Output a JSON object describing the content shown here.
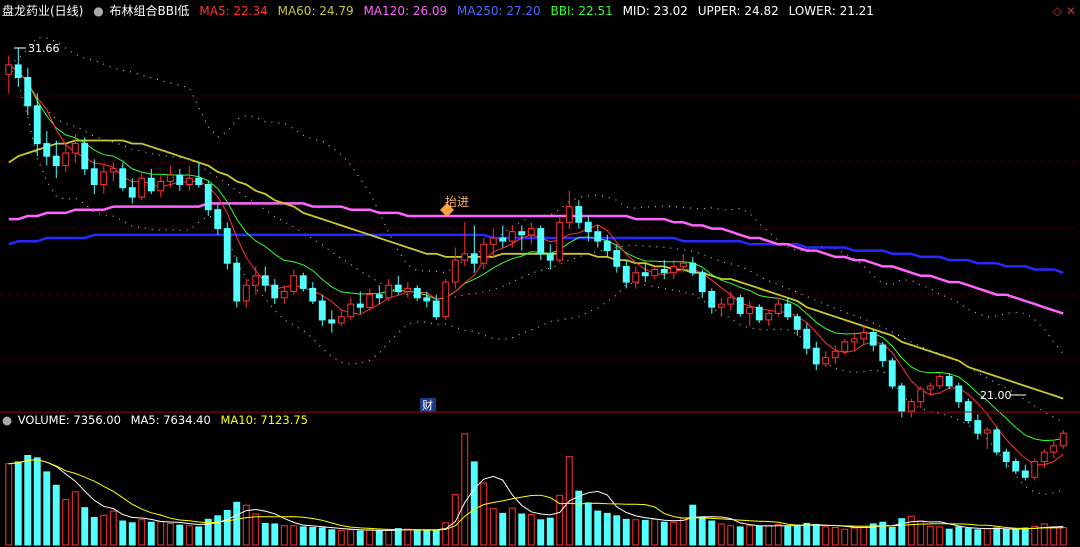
{
  "header": {
    "stock": "盘龙药业(日线)",
    "indicator_icon": "dot-icon",
    "indicator": "布林组合BBI低",
    "ma5": "MA5: 22.34",
    "ma60": "MA60: 24.79",
    "ma120": "MA120: 26.09",
    "ma250": "MA250: 27.20",
    "bbi": "BBI: 22.51",
    "mid": "MID: 23.02",
    "upper": "UPPER: 24.82",
    "lower": "LOWER: 21.21"
  },
  "volume_header": {
    "volume_icon": "circle-icon",
    "volume": "VOLUME: 7356.00",
    "ma5": "MA5: 7634.40",
    "ma10": "MA10: 7123.75"
  },
  "chart_labels": {
    "high_price": "31.66",
    "low_price": "21.00",
    "marker_text": "抬进",
    "caibao_tag": "财"
  },
  "colors": {
    "background": "#000000",
    "up_candle": "#ff3232",
    "down_candle": "#54ffff",
    "ma5": "#ff3232",
    "ma60": "#c8c832",
    "ma120": "#ff64ff",
    "ma250": "#2828ff",
    "bbi": "#32ff32",
    "mid": "#ffffff",
    "vol_ma5": "#ffffff",
    "vol_ma10": "#ffff00",
    "grid": "#7a0000",
    "header_stock": "#ffffff",
    "header_ma5": "#ff3232",
    "header_ma60": "#c8c832",
    "header_ma120": "#ff64ff",
    "header_ma250": "#4a6aff",
    "header_bbi": "#32ff32",
    "header_text": "#ffffff",
    "marker": "#ffa040",
    "caibao_bg": "#1a3a8a"
  },
  "chart_data": [
    {
      "type": "candlestick",
      "name": "price",
      "high_label": 31.66,
      "low_label": 21.0,
      "ylim": [
        20.2,
        32.4
      ],
      "candles": [
        [
          30.8,
          31.4,
          30.2,
          31.1
        ],
        [
          31.1,
          31.66,
          30.4,
          30.7
        ],
        [
          30.7,
          31.0,
          29.5,
          29.8
        ],
        [
          29.8,
          30.2,
          28.2,
          28.6
        ],
        [
          28.6,
          29.0,
          27.9,
          28.2
        ],
        [
          28.2,
          28.7,
          27.5,
          27.9
        ],
        [
          27.9,
          28.6,
          27.7,
          28.3
        ],
        [
          28.3,
          28.9,
          28.0,
          28.6
        ],
        [
          28.6,
          28.8,
          27.6,
          27.8
        ],
        [
          27.8,
          28.1,
          27.0,
          27.3
        ],
        [
          27.3,
          27.9,
          27.0,
          27.7
        ],
        [
          27.7,
          28.0,
          27.4,
          27.8
        ],
        [
          27.8,
          28.0,
          27.1,
          27.2
        ],
        [
          27.2,
          27.5,
          26.7,
          26.9
        ],
        [
          26.9,
          27.7,
          26.8,
          27.5
        ],
        [
          27.5,
          27.8,
          27.0,
          27.1
        ],
        [
          27.1,
          27.6,
          26.9,
          27.4
        ],
        [
          27.4,
          27.9,
          27.2,
          27.6
        ],
        [
          27.6,
          27.8,
          27.1,
          27.3
        ],
        [
          27.3,
          27.9,
          27.1,
          27.5
        ],
        [
          27.5,
          28.0,
          27.2,
          27.3
        ],
        [
          27.3,
          27.4,
          26.3,
          26.5
        ],
        [
          26.5,
          26.7,
          25.7,
          25.9
        ],
        [
          25.9,
          26.1,
          24.6,
          24.8
        ],
        [
          24.8,
          25.0,
          23.4,
          23.6
        ],
        [
          23.6,
          24.3,
          23.4,
          24.1
        ],
        [
          24.1,
          24.7,
          23.8,
          24.4
        ],
        [
          24.4,
          24.7,
          23.9,
          24.1
        ],
        [
          24.1,
          24.3,
          23.5,
          23.7
        ],
        [
          23.7,
          24.1,
          23.5,
          23.9
        ],
        [
          23.9,
          24.6,
          23.8,
          24.4
        ],
        [
          24.4,
          24.5,
          23.9,
          24.0
        ],
        [
          24.0,
          24.2,
          23.5,
          23.6
        ],
        [
          23.6,
          23.8,
          22.8,
          23.0
        ],
        [
          23.0,
          23.3,
          22.6,
          22.9
        ],
        [
          22.9,
          23.3,
          22.8,
          23.1
        ],
        [
          23.1,
          23.7,
          23.0,
          23.5
        ],
        [
          23.5,
          23.9,
          23.2,
          23.4
        ],
        [
          23.4,
          24.0,
          23.3,
          23.8
        ],
        [
          23.8,
          24.1,
          23.5,
          23.7
        ],
        [
          23.7,
          24.3,
          23.6,
          24.1
        ],
        [
          24.1,
          24.4,
          23.8,
          23.9
        ],
        [
          23.9,
          24.2,
          23.7,
          24.0
        ],
        [
          24.0,
          24.1,
          23.6,
          23.7
        ],
        [
          23.7,
          23.9,
          23.4,
          23.6
        ],
        [
          23.6,
          23.8,
          23.0,
          23.1
        ],
        [
          23.1,
          24.3,
          23.0,
          24.2
        ],
        [
          24.2,
          25.3,
          24.0,
          24.9
        ],
        [
          24.9,
          26.1,
          24.7,
          25.1
        ],
        [
          25.1,
          26.0,
          24.5,
          24.8
        ],
        [
          24.8,
          25.6,
          24.6,
          25.4
        ],
        [
          25.4,
          25.9,
          25.0,
          25.6
        ],
        [
          25.6,
          26.0,
          25.3,
          25.5
        ],
        [
          25.5,
          26.0,
          25.3,
          25.8
        ],
        [
          25.8,
          26.0,
          25.2,
          25.7
        ],
        [
          25.7,
          26.1,
          25.4,
          25.9
        ],
        [
          25.9,
          26.0,
          24.9,
          25.1
        ],
        [
          25.1,
          25.4,
          24.6,
          24.9
        ],
        [
          24.9,
          26.3,
          24.8,
          26.1
        ],
        [
          26.1,
          27.1,
          25.9,
          26.6
        ],
        [
          26.6,
          26.8,
          25.9,
          26.1
        ],
        [
          26.1,
          26.3,
          25.5,
          25.8
        ],
        [
          25.8,
          26.0,
          25.3,
          25.5
        ],
        [
          25.5,
          25.7,
          25.0,
          25.2
        ],
        [
          25.2,
          25.4,
          24.5,
          24.7
        ],
        [
          24.7,
          24.9,
          24.0,
          24.2
        ],
        [
          24.2,
          24.7,
          24.0,
          24.5
        ],
        [
          24.5,
          24.8,
          24.2,
          24.4
        ],
        [
          24.4,
          24.7,
          24.3,
          24.6
        ],
        [
          24.6,
          24.9,
          24.3,
          24.5
        ],
        [
          24.5,
          24.9,
          24.3,
          24.7
        ],
        [
          24.7,
          25.1,
          24.5,
          24.8
        ],
        [
          24.8,
          25.0,
          24.4,
          24.5
        ],
        [
          24.5,
          24.6,
          23.7,
          23.9
        ],
        [
          23.9,
          24.0,
          23.2,
          23.4
        ],
        [
          23.4,
          23.7,
          23.1,
          23.5
        ],
        [
          23.5,
          23.9,
          23.3,
          23.7
        ],
        [
          23.7,
          23.8,
          23.1,
          23.2
        ],
        [
          23.2,
          23.6,
          22.8,
          23.4
        ],
        [
          23.4,
          23.5,
          22.9,
          23.0
        ],
        [
          23.0,
          23.3,
          22.8,
          23.2
        ],
        [
          23.2,
          23.7,
          23.1,
          23.5
        ],
        [
          23.5,
          23.7,
          23.0,
          23.1
        ],
        [
          23.1,
          23.2,
          22.5,
          22.7
        ],
        [
          22.7,
          22.9,
          21.9,
          22.1
        ],
        [
          22.1,
          22.3,
          21.4,
          21.6
        ],
        [
          21.6,
          22.0,
          21.5,
          21.8
        ],
        [
          21.8,
          22.2,
          21.6,
          22.0
        ],
        [
          22.0,
          22.4,
          21.9,
          22.3
        ],
        [
          22.3,
          22.6,
          22.0,
          22.4
        ],
        [
          22.4,
          22.8,
          22.2,
          22.6
        ],
        [
          22.6,
          22.7,
          22.0,
          22.2
        ],
        [
          22.2,
          22.3,
          21.5,
          21.7
        ],
        [
          21.7,
          21.8,
          20.8,
          20.9
        ],
        [
          20.9,
          21.0,
          19.9,
          20.1
        ],
        [
          20.1,
          20.5,
          19.9,
          20.4
        ],
        [
          20.4,
          20.9,
          20.2,
          20.8
        ],
        [
          20.8,
          21.0,
          20.6,
          20.9
        ],
        [
          20.9,
          21.3,
          20.8,
          21.2
        ],
        [
          21.2,
          21.3,
          20.8,
          20.9
        ],
        [
          20.9,
          21.0,
          20.2,
          20.4
        ],
        [
          20.4,
          20.5,
          19.7,
          19.8
        ],
        [
          19.8,
          20.0,
          19.2,
          19.4
        ],
        [
          19.4,
          19.6,
          18.9,
          19.5
        ],
        [
          19.5,
          19.6,
          18.7,
          18.8
        ],
        [
          18.8,
          18.9,
          18.3,
          18.5
        ],
        [
          18.5,
          18.6,
          18.1,
          18.2
        ],
        [
          18.2,
          18.4,
          17.9,
          18.0
        ],
        [
          18.0,
          18.6,
          17.9,
          18.5
        ],
        [
          18.5,
          18.9,
          18.3,
          18.8
        ],
        [
          18.8,
          19.2,
          18.6,
          19.0
        ],
        [
          19.0,
          19.5,
          18.9,
          19.4
        ]
      ],
      "ma60": [
        28.0,
        28.2,
        28.3,
        28.4,
        28.5,
        28.6,
        28.6,
        28.7,
        28.7,
        28.7,
        28.7,
        28.7,
        28.7,
        28.6,
        28.6,
        28.5,
        28.4,
        28.3,
        28.2,
        28.1,
        28.0,
        27.9,
        27.7,
        27.6,
        27.4,
        27.3,
        27.1,
        27.0,
        26.8,
        26.7,
        26.6,
        26.4,
        26.3,
        26.2,
        26.1,
        26.0,
        25.9,
        25.8,
        25.7,
        25.6,
        25.5,
        25.4,
        25.3,
        25.2,
        25.1,
        25.1,
        25.0,
        25.0,
        25.0,
        25.0,
        25.0,
        25.0,
        25.1,
        25.1,
        25.1,
        25.1,
        25.1,
        25.1,
        25.1,
        25.1,
        25.1,
        25.1,
        25.0,
        25.0,
        24.9,
        24.9,
        24.8,
        24.8,
        24.7,
        24.7,
        24.6,
        24.6,
        24.5,
        24.5,
        24.4,
        24.3,
        24.3,
        24.2,
        24.1,
        24.0,
        23.9,
        23.8,
        23.7,
        23.6,
        23.4,
        23.3,
        23.2,
        23.1,
        23.0,
        22.9,
        22.8,
        22.7,
        22.6,
        22.5,
        22.3,
        22.2,
        22.1,
        22.0,
        21.9,
        21.8,
        21.7,
        21.5,
        21.4,
        21.3,
        21.2,
        21.1,
        21.0,
        20.9,
        20.8,
        20.7,
        20.6,
        20.5
      ],
      "ma120": [
        26.2,
        26.2,
        26.3,
        26.3,
        26.4,
        26.4,
        26.4,
        26.5,
        26.5,
        26.5,
        26.5,
        26.6,
        26.6,
        26.6,
        26.6,
        26.6,
        26.6,
        26.6,
        26.6,
        26.6,
        26.6,
        26.7,
        26.7,
        26.7,
        26.7,
        26.7,
        26.7,
        26.7,
        26.7,
        26.7,
        26.7,
        26.7,
        26.6,
        26.6,
        26.6,
        26.6,
        26.5,
        26.5,
        26.5,
        26.4,
        26.4,
        26.4,
        26.3,
        26.3,
        26.3,
        26.3,
        26.3,
        26.3,
        26.3,
        26.3,
        26.3,
        26.3,
        26.3,
        26.3,
        26.3,
        26.3,
        26.3,
        26.3,
        26.3,
        26.3,
        26.3,
        26.3,
        26.3,
        26.3,
        26.3,
        26.3,
        26.2,
        26.2,
        26.2,
        26.2,
        26.1,
        26.1,
        26.0,
        26.0,
        25.9,
        25.9,
        25.8,
        25.7,
        25.6,
        25.6,
        25.5,
        25.4,
        25.4,
        25.3,
        25.2,
        25.2,
        25.1,
        25.0,
        25.0,
        24.9,
        24.9,
        24.8,
        24.7,
        24.7,
        24.6,
        24.5,
        24.4,
        24.4,
        24.3,
        24.2,
        24.2,
        24.1,
        24.0,
        23.9,
        23.8,
        23.8,
        23.7,
        23.6,
        23.5,
        23.4,
        23.3,
        23.2
      ],
      "ma250": [
        25.4,
        25.5,
        25.5,
        25.5,
        25.6,
        25.6,
        25.6,
        25.6,
        25.6,
        25.7,
        25.7,
        25.7,
        25.7,
        25.7,
        25.7,
        25.7,
        25.7,
        25.7,
        25.7,
        25.7,
        25.7,
        25.7,
        25.7,
        25.7,
        25.7,
        25.7,
        25.7,
        25.7,
        25.7,
        25.7,
        25.7,
        25.7,
        25.7,
        25.7,
        25.7,
        25.7,
        25.7,
        25.7,
        25.7,
        25.7,
        25.7,
        25.7,
        25.7,
        25.7,
        25.7,
        25.7,
        25.7,
        25.7,
        25.7,
        25.7,
        25.7,
        25.6,
        25.6,
        25.6,
        25.6,
        25.6,
        25.6,
        25.6,
        25.6,
        25.6,
        25.6,
        25.6,
        25.6,
        25.6,
        25.6,
        25.6,
        25.6,
        25.6,
        25.6,
        25.6,
        25.6,
        25.5,
        25.5,
        25.5,
        25.5,
        25.5,
        25.5,
        25.5,
        25.4,
        25.4,
        25.4,
        25.4,
        25.4,
        25.4,
        25.3,
        25.3,
        25.3,
        25.3,
        25.3,
        25.2,
        25.2,
        25.2,
        25.2,
        25.1,
        25.1,
        25.1,
        25.0,
        25.0,
        25.0,
        24.9,
        24.9,
        24.9,
        24.8,
        24.8,
        24.8,
        24.7,
        24.7,
        24.7,
        24.6,
        24.6,
        24.6,
        24.5
      ]
    },
    {
      "type": "bar",
      "name": "volume",
      "ylim": [
        0,
        20000
      ],
      "values": [
        13900,
        14200,
        15300,
        14900,
        12500,
        10200,
        7800,
        9100,
        6400,
        4700,
        5100,
        5800,
        4100,
        3800,
        4300,
        3900,
        4000,
        3700,
        3400,
        3300,
        3100,
        4400,
        5000,
        5900,
        7300,
        6800,
        5300,
        3700,
        3600,
        3300,
        3300,
        3100,
        3000,
        2900,
        2600,
        2500,
        2600,
        2400,
        2600,
        2400,
        2500,
        2800,
        2700,
        2600,
        2400,
        2500,
        3800,
        8600,
        19000,
        14200,
        10600,
        6200,
        5400,
        6300,
        5300,
        5200,
        4300,
        4600,
        8500,
        15100,
        9200,
        7200,
        5800,
        5400,
        5000,
        4400,
        4300,
        4200,
        4400,
        3900,
        3900,
        4600,
        6800,
        4800,
        4100,
        3600,
        3300,
        3100,
        3300,
        3200,
        3300,
        3500,
        3200,
        3400,
        3700,
        3500,
        3100,
        3000,
        2700,
        2900,
        3200,
        3600,
        3900,
        3000,
        4500,
        4900,
        4100,
        3200,
        3100,
        2700,
        3100,
        2800,
        2600,
        2800,
        2900,
        2700,
        2600,
        2900,
        3200,
        3600,
        3100,
        3000
      ],
      "up": [
        true,
        false,
        false,
        false,
        false,
        false,
        true,
        true,
        false,
        false,
        true,
        true,
        false,
        false,
        true,
        false,
        true,
        true,
        false,
        true,
        false,
        false,
        false,
        false,
        false,
        true,
        true,
        false,
        false,
        true,
        true,
        false,
        false,
        false,
        false,
        true,
        true,
        false,
        true,
        false,
        true,
        false,
        true,
        false,
        false,
        false,
        true,
        true,
        true,
        false,
        true,
        true,
        false,
        true,
        false,
        true,
        false,
        false,
        true,
        true,
        false,
        false,
        false,
        false,
        false,
        false,
        true,
        false,
        true,
        false,
        true,
        true,
        false,
        false,
        false,
        true,
        true,
        false,
        true,
        false,
        true,
        true,
        false,
        false,
        false,
        false,
        true,
        true,
        true,
        true,
        true,
        false,
        false,
        false,
        false,
        true,
        true,
        true,
        true,
        false,
        false,
        false,
        false,
        true,
        false,
        false,
        false,
        false,
        true,
        true,
        true,
        true
      ]
    }
  ]
}
